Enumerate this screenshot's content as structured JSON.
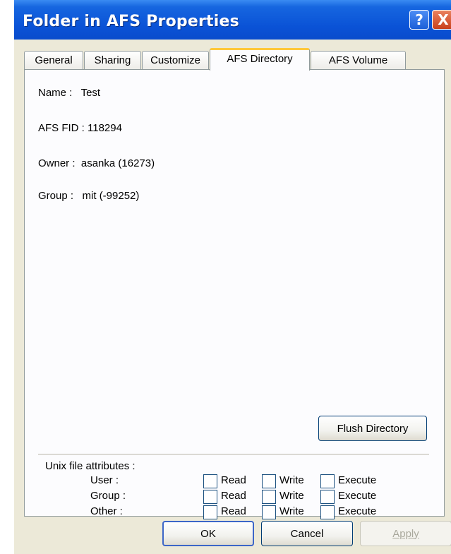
{
  "window": {
    "title": "Folder in AFS Properties"
  },
  "titlebar_buttons": {
    "help": "?",
    "close": "X"
  },
  "tabs": [
    {
      "label": "General"
    },
    {
      "label": "Sharing"
    },
    {
      "label": "Customize"
    },
    {
      "label": "AFS Directory",
      "active": true
    },
    {
      "label": "AFS Volume"
    }
  ],
  "info": {
    "name": "Name :   Test",
    "fid": "AFS FID : 118294",
    "owner": "Owner :  asanka (16273)",
    "group": "Group :   mit (-99252)"
  },
  "flush_button": "Flush Directory",
  "unix": {
    "heading": "Unix file attributes :",
    "rows": [
      {
        "label": "User :"
      },
      {
        "label": "Group :"
      },
      {
        "label": "Other :"
      }
    ],
    "columns": [
      "Read",
      "Write",
      "Execute"
    ]
  },
  "buttons": {
    "ok": "OK",
    "cancel": "Cancel",
    "apply": "Apply"
  },
  "colors": {
    "titlebar": "#0a52d6",
    "face": "#ece9d8",
    "panel": "#fcfcfe",
    "active_tab_accent": "#ffc83c"
  }
}
